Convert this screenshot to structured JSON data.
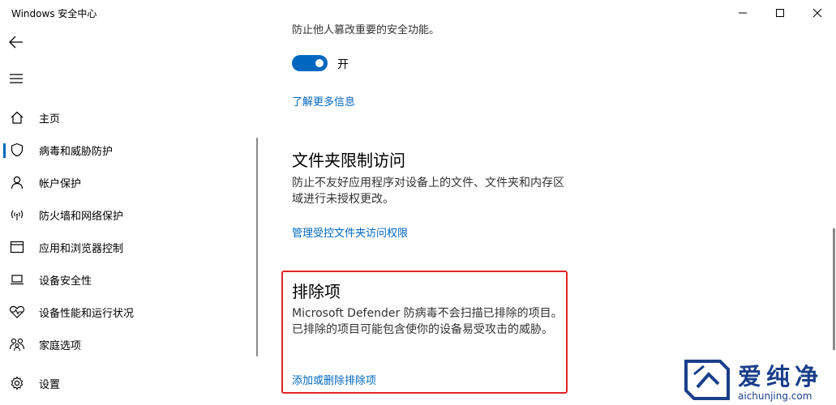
{
  "window": {
    "title": "Windows 安全中心"
  },
  "sidebar": {
    "items": [
      {
        "label": "主页",
        "icon": "home-icon"
      },
      {
        "label": "病毒和威胁防护",
        "icon": "shield-icon"
      },
      {
        "label": "帐户保护",
        "icon": "person-icon"
      },
      {
        "label": "防火墙和网络保护",
        "icon": "wireless-signal-icon"
      },
      {
        "label": "应用和浏览器控制",
        "icon": "app-window-icon"
      },
      {
        "label": "设备安全性",
        "icon": "laptop-icon"
      },
      {
        "label": "设备性能和运行状况",
        "icon": "heart-pulse-icon"
      },
      {
        "label": "家庭选项",
        "icon": "family-icon"
      },
      {
        "label": "设置",
        "icon": "gear-icon"
      }
    ],
    "active_index": 1
  },
  "main": {
    "partial_text": "防止他人篡改重要的安全功能。",
    "toggle": {
      "label": "开",
      "on": true
    },
    "learn_more_link": "了解更多信息",
    "folder_access": {
      "title": "文件夹限制访问",
      "description": "防止不友好应用程序对设备上的文件、文件夹和内存区域进行未授权更改。",
      "link": "管理受控文件夹访问权限"
    },
    "exclusions": {
      "title": "排除项",
      "description": "Microsoft Defender 防病毒不会扫描已排除的项目。已排除的项目可能包含使你的设备易受攻击的威胁。",
      "link": "添加或删除排除项"
    }
  },
  "watermark": {
    "text": "爱纯净",
    "url": "aichunjing.com"
  },
  "colors": {
    "accent": "#0067c0",
    "highlight_border": "#e02424",
    "watermark": "#1a3f8a"
  }
}
